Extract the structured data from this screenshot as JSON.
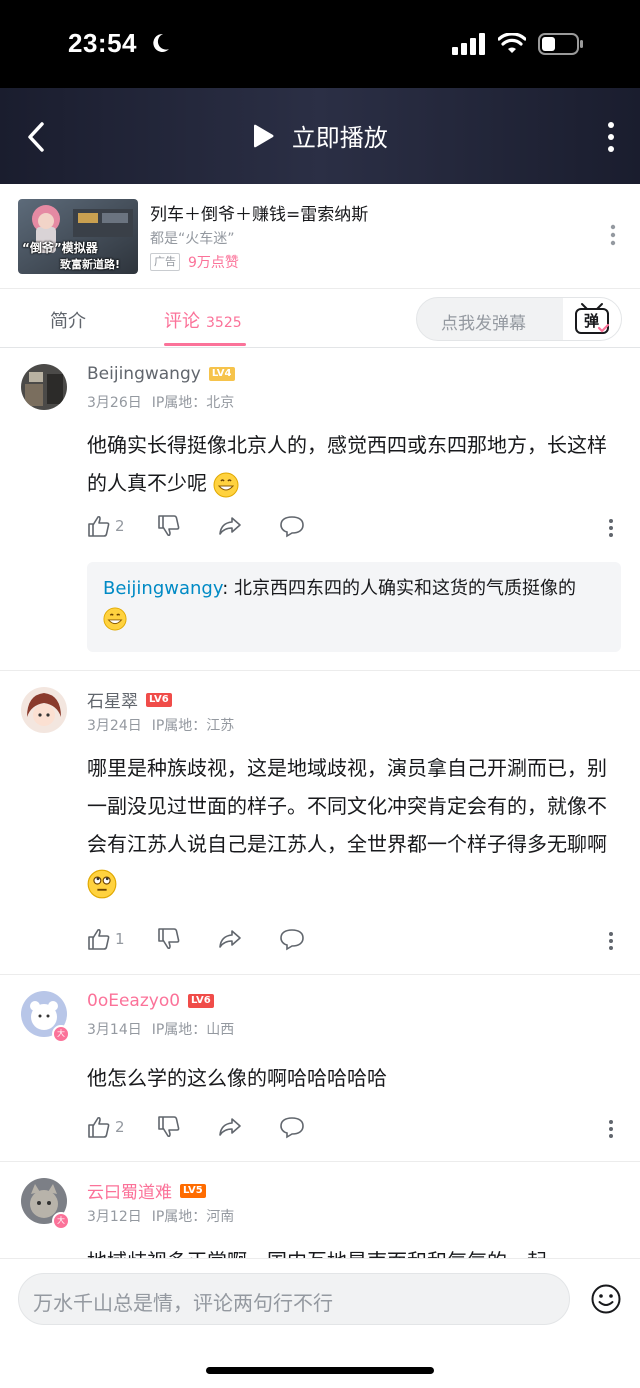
{
  "status": {
    "time": "23:54"
  },
  "nav": {
    "title": "立即播放"
  },
  "ad": {
    "thumb_text_1": "“倒爷”模拟器",
    "thumb_text_2": "致富新道路!",
    "title": "列车＋倒爷＋赚钱=雷索纳斯",
    "subtitle": "都是“火车迷”",
    "tag": "广告",
    "likes": "9万点赞"
  },
  "tabs": {
    "intro": "简介",
    "comments": "评论",
    "comments_count": "3525"
  },
  "danmaku": {
    "placeholder": "点我发弹幕",
    "button_label": "弹"
  },
  "comments": [
    {
      "user": "Beijingwangy",
      "level": "LV4",
      "level_color": "#f6c34b",
      "date": "3月26日",
      "location": "IP属地：北京",
      "text": "他确实长得挺像北京人的，感觉西四或东四那地方，长这样的人真不少呢",
      "likes": "2",
      "reply": {
        "user": "Beijingwangy",
        "text": "北京西四东四的人确实和这货的气质挺像的"
      }
    },
    {
      "user": "石星翠",
      "level": "LV6",
      "level_color": "#f04c49",
      "date": "3月24日",
      "location": "IP属地：江苏",
      "text": "哪里是种族歧视，这是地域歧视，演员拿自己开涮而已，别一副没见过世面的样子。不同文化冲突肯定会有的，就像不会有江苏人说自己是江苏人，全世界都一个样子得多无聊啊",
      "likes": "1"
    },
    {
      "user": "0oEeazyo0",
      "level": "LV6",
      "level_color": "#f04c49",
      "date": "3月14日",
      "location": "IP属地：山西",
      "text": "他怎么学的这么像的啊哈哈哈哈哈",
      "likes": "2"
    },
    {
      "user": "云曰蜀道难",
      "level": "LV5",
      "level_color": "#ff6c00",
      "date": "3月12日",
      "location": "IP属地：河南",
      "text": "地域歧视多正常啊，国内互地是南面和和气气的一起"
    }
  ],
  "bottom": {
    "placeholder": "万水千山总是情，评论两句行不行"
  }
}
